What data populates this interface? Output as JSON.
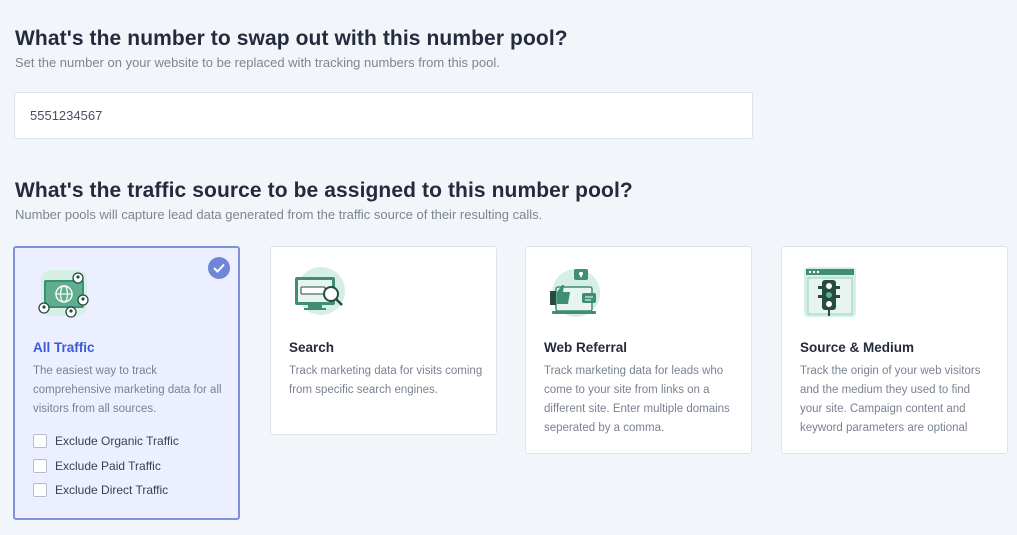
{
  "swap": {
    "heading": "What's the number to swap out with this number pool?",
    "subheading": "Set the number on your website to be replaced with tracking numbers from this pool.",
    "number_value": "5551234567"
  },
  "source": {
    "heading": "What's the traffic source to be assigned to this number pool?",
    "subheading": "Number pools will capture lead data generated from the traffic source of their resulting calls.",
    "cards": [
      {
        "title": "All Traffic",
        "description": "The easiest way to track comprehensive marketing data for all visitors from all sources.",
        "icon": "globe-network-icon",
        "selected": true,
        "options": [
          {
            "label": "Exclude Organic Traffic",
            "checked": false
          },
          {
            "label": "Exclude Paid Traffic",
            "checked": false
          },
          {
            "label": "Exclude Direct Traffic",
            "checked": false
          }
        ]
      },
      {
        "title": "Search",
        "description": "Track marketing data for visits coming from specific search engines.",
        "icon": "search-monitor-icon",
        "selected": false
      },
      {
        "title": "Web Referral",
        "description": "Track marketing data for leads who come to your site from links on a different site. Enter multiple domains seperated by a comma.",
        "icon": "referral-thumbs-up-icon",
        "selected": false
      },
      {
        "title": "Source & Medium",
        "description": "Track the origin of your web visitors and the medium they used to find your site. Campaign content and keyword parameters are optional",
        "icon": "traffic-light-icon",
        "selected": false
      }
    ]
  },
  "colors": {
    "background": "#f2f6fa",
    "selected_card_bg": "#ecefff",
    "selected_border": "#7f91d8",
    "accent_blue": "#3b5bd1",
    "illustration_green": "#3f8d73"
  }
}
